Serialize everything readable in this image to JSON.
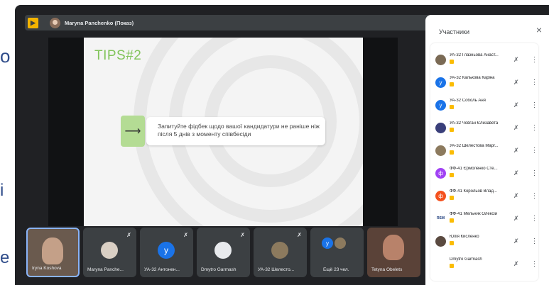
{
  "background": {
    "frag_o": "o",
    "frag_i": "i",
    "frag_e": "e"
  },
  "presenter": {
    "logo": "▶",
    "name": "Maryna Panchenko (Показ)"
  },
  "slide": {
    "title": "TIPS#2",
    "arrow": "⟶",
    "text": "Запитуйте фідбек щодо вашої кандидатури не раніше ніж після 5 днів з моменту співбесіди"
  },
  "panel": {
    "title": "Участники",
    "close": "×",
    "participants": [
      {
        "name": "УА-32 Глазньова Анаст...",
        "avatar": "",
        "avatar_color": "#7a6a55"
      },
      {
        "name": "УА-32 Калькова Каріна",
        "avatar": "у",
        "avatar_color": "#1a73e8"
      },
      {
        "name": "УА-32 Соболь Аня",
        "avatar": "у",
        "avatar_color": "#1a73e8"
      },
      {
        "name": "УА-32 Човган Єлизавета",
        "avatar": "",
        "avatar_color": "#3a3f7a"
      },
      {
        "name": "УА-32 Шелестова Марг...",
        "avatar": "",
        "avatar_color": "#8c7a5e"
      },
      {
        "name": "ФФ-41 Єрмоленко Сте...",
        "avatar": "ф",
        "avatar_color": "#a142f4"
      },
      {
        "name": "ФФ-41 Корольов Влад...",
        "avatar": "ф",
        "avatar_color": "#f4511e"
      },
      {
        "name": "ФФ-41 Мельник Олексій",
        "avatar": "RSM",
        "avatar_color": "#ffffff"
      },
      {
        "name": "Юлія Кисленко",
        "avatar": "",
        "avatar_color": "#5a4a40"
      },
      {
        "name": "Dmytro Garmash",
        "avatar": "",
        "avatar_color": "#ffffff"
      }
    ]
  },
  "tiles": [
    {
      "name": "Iryna Koshova"
    },
    {
      "name": "Maryna Panche..."
    },
    {
      "name": "УА-32 Антонен...",
      "avatar": "у"
    },
    {
      "name": "Dmytro Garmash"
    },
    {
      "name": "УА-32 Шелесто..."
    },
    {
      "name": "Ещё 23 чел.",
      "avatar": "у"
    },
    {
      "name": "Tetyna Obelets"
    }
  ],
  "icons": {
    "mic_off": "✗",
    "more": "⋮"
  }
}
